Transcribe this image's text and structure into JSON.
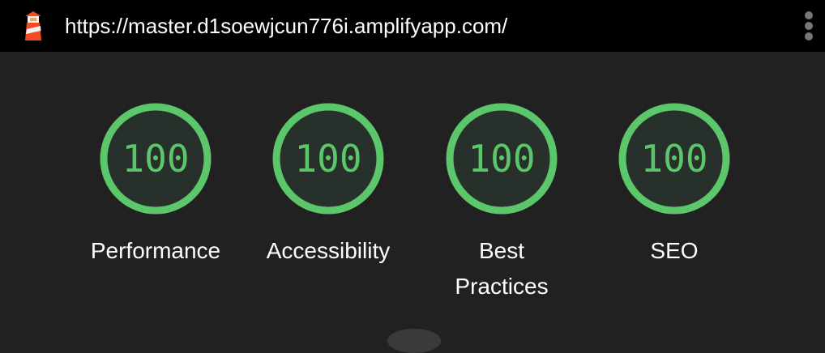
{
  "browser": {
    "url": "https://master.d1soewjcun776i.amplifyapp.com/",
    "logo_icon": "lighthouse-icon",
    "menu_icon": "more-vert-icon"
  },
  "colors": {
    "pass_stroke": "#5bc76a",
    "pass_fill": "#27302a",
    "pass_text": "#5bc76a",
    "background": "#212121",
    "topbar": "#000000"
  },
  "gauges": [
    {
      "label": "Performance",
      "score": "100",
      "fraction": 1.0
    },
    {
      "label": "Accessibility",
      "score": "100",
      "fraction": 1.0
    },
    {
      "label": "Best Practices",
      "score": "100",
      "fraction": 1.0
    },
    {
      "label": "SEO",
      "score": "100",
      "fraction": 1.0
    }
  ]
}
